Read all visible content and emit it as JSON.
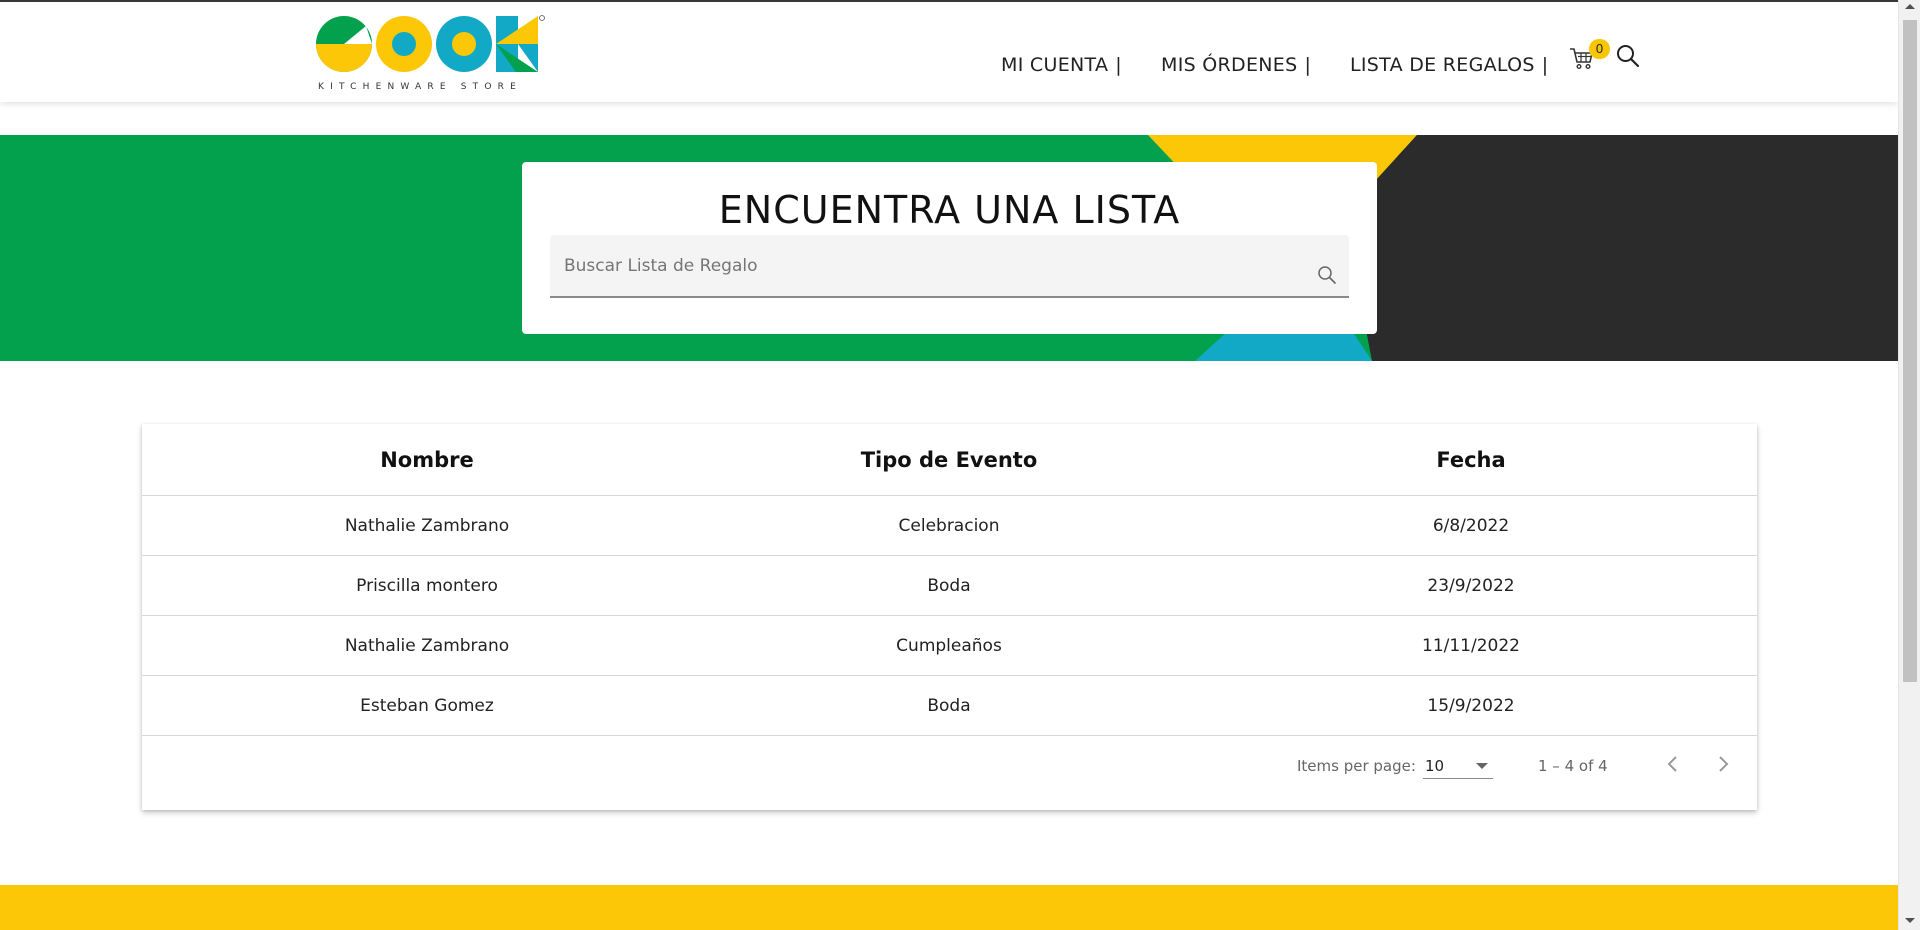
{
  "header": {
    "logo_text": "COOK",
    "logo_subtitle": "KITCHENWARE STORE",
    "nav": [
      {
        "label": "MI CUENTA",
        "sep": "|"
      },
      {
        "label": "MIS ÓRDENES",
        "sep": "|"
      },
      {
        "label": "LISTA DE REGALOS",
        "sep": "|"
      }
    ],
    "cart_count": "0",
    "icons": {
      "cart": "cart-icon",
      "search": "search-icon"
    }
  },
  "hero": {
    "title": "ENCUENTRA UNA LISTA",
    "search_placeholder": "Buscar Lista de Regalo",
    "search_value": "",
    "colors": {
      "green": "#03a04d",
      "yellow": "#fcc706",
      "dark": "#2b2b2b",
      "blue": "#11a9c6"
    }
  },
  "table": {
    "columns": [
      "Nombre",
      "Tipo de Evento",
      "Fecha"
    ],
    "rows": [
      [
        "Nathalie Zambrano",
        "Celebracion",
        "6/8/2022"
      ],
      [
        "Priscilla montero",
        "Boda",
        "23/9/2022"
      ],
      [
        "Nathalie Zambrano",
        "Cumpleaños",
        "11/11/2022"
      ],
      [
        "Esteban Gomez",
        "Boda",
        "15/9/2022"
      ]
    ],
    "paginator": {
      "items_per_page_label": "Items per page:",
      "items_per_page_value": "10",
      "range_label": "1 – 4 of 4"
    }
  },
  "footer": {
    "color": "#fcc706"
  }
}
